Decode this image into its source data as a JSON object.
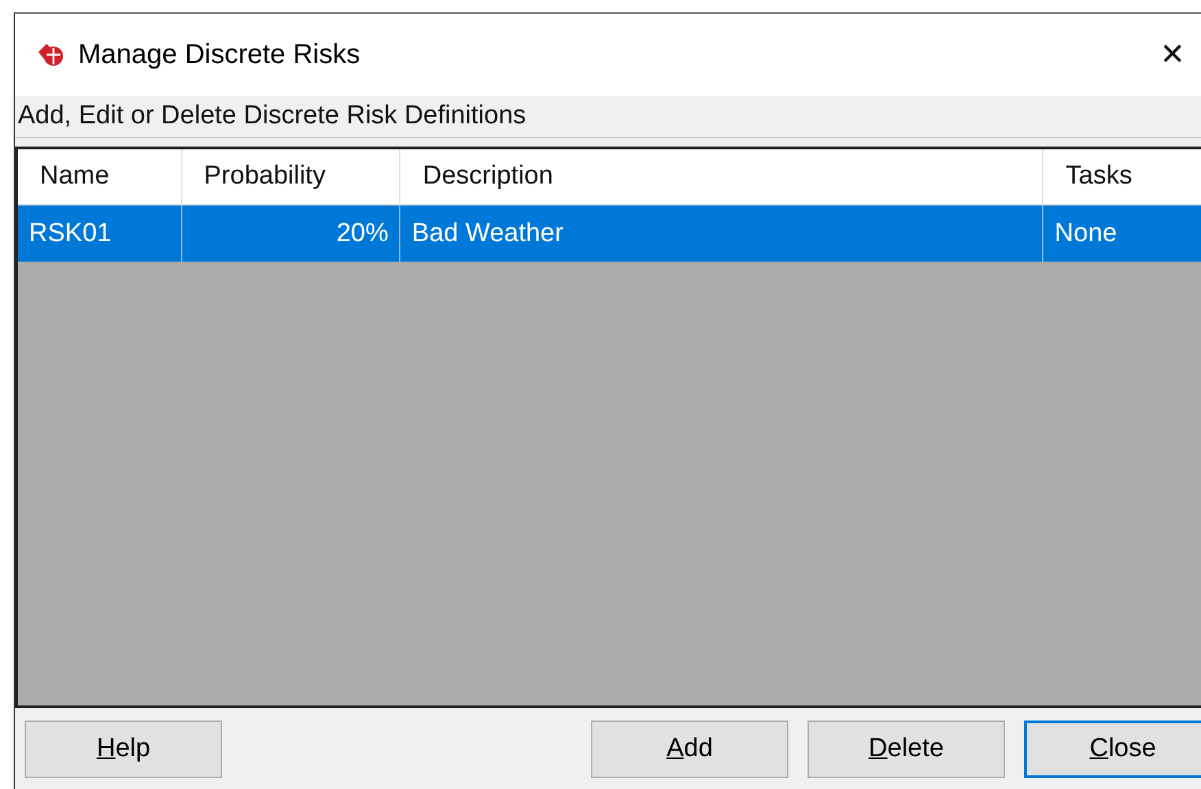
{
  "window": {
    "title": "Manage Discrete Risks",
    "close": "✕"
  },
  "subtitle": "Add, Edit or Delete Discrete Risk Definitions",
  "table": {
    "columns": [
      "Name",
      "Probability",
      "Description",
      "Tasks"
    ],
    "rows": [
      {
        "cells": [
          "RSK01",
          "20%",
          "Bad Weather",
          "None"
        ],
        "selected": true
      }
    ]
  },
  "buttons": [
    {
      "label": "Help",
      "default": false
    },
    {
      "label": "Add",
      "default": false
    },
    {
      "label": "Delete",
      "default": false
    },
    {
      "label": "Close",
      "default": true
    }
  ]
}
